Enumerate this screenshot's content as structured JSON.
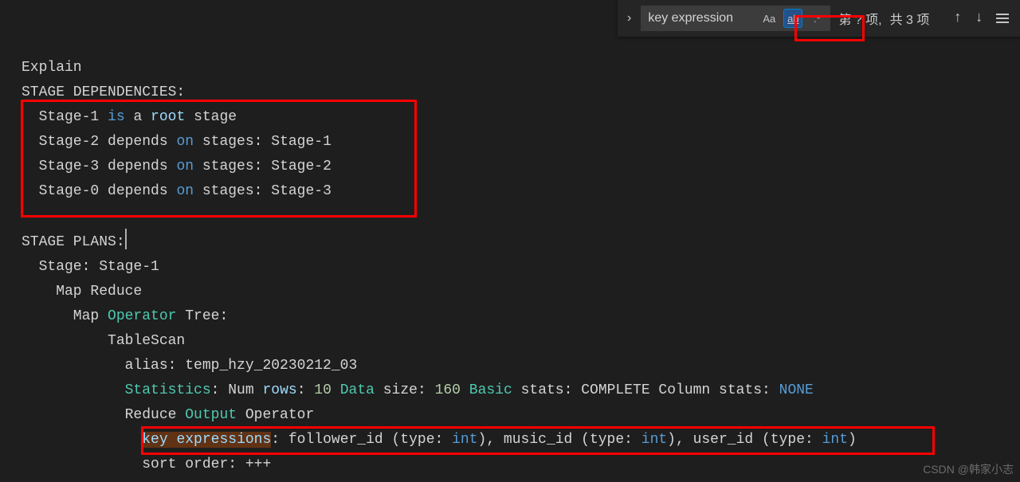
{
  "find": {
    "value": "key expression",
    "match_info_1": "第 ? 项,",
    "match_info_2": "共 3 项"
  },
  "code": {
    "l1": "Explain",
    "l2": "STAGE DEPENDENCIES:",
    "l3_a": "  Stage-1 ",
    "l3_is": "is",
    "l3_b": " a ",
    "l3_root": "root",
    "l3_c": " stage",
    "l4_a": "  Stage-2 depends ",
    "l4_on": "on",
    "l4_b": " stages: Stage-1",
    "l5_a": "  Stage-3 depends ",
    "l5_on": "on",
    "l5_b": " stages: Stage-2",
    "l6_a": "  Stage-0 depends ",
    "l6_on": "on",
    "l6_b": " stages: Stage-3",
    "l7": "",
    "l8": "STAGE PLANS:",
    "l9": "  Stage: Stage-1",
    "l10": "    Map Reduce",
    "l11_a": "      Map ",
    "l11_op": "Operator",
    "l11_b": " Tree:",
    "l12": "          TableScan",
    "l13": "            alias: temp_hzy_20230212_03",
    "l14_a": "            ",
    "l14_stat": "Statistics",
    "l14_b": ": Num ",
    "l14_rows": "rows",
    "l14_c": ": ",
    "l14_n1": "10",
    "l14_d": " ",
    "l14_data": "Data",
    "l14_e": " size: ",
    "l14_n2": "160",
    "l14_f": " ",
    "l14_basic": "Basic",
    "l14_g": " stats: COMPLETE Column stats: ",
    "l14_none": "NONE",
    "l15_a": "            Reduce ",
    "l15_out": "Output",
    "l15_b": " Operator",
    "l16_a": "              ",
    "l16_key": "key",
    "l16_sp1": " ",
    "l16_exp": "expressions",
    "l16_b": ": follower_id (type: ",
    "l16_int1": "int",
    "l16_c": "), music_id (type: ",
    "l16_int2": "int",
    "l16_d": "), user_id (type: ",
    "l16_int3": "int",
    "l16_e": ")",
    "l17": "              sort order: +++"
  },
  "watermark": "CSDN @韩家小志"
}
